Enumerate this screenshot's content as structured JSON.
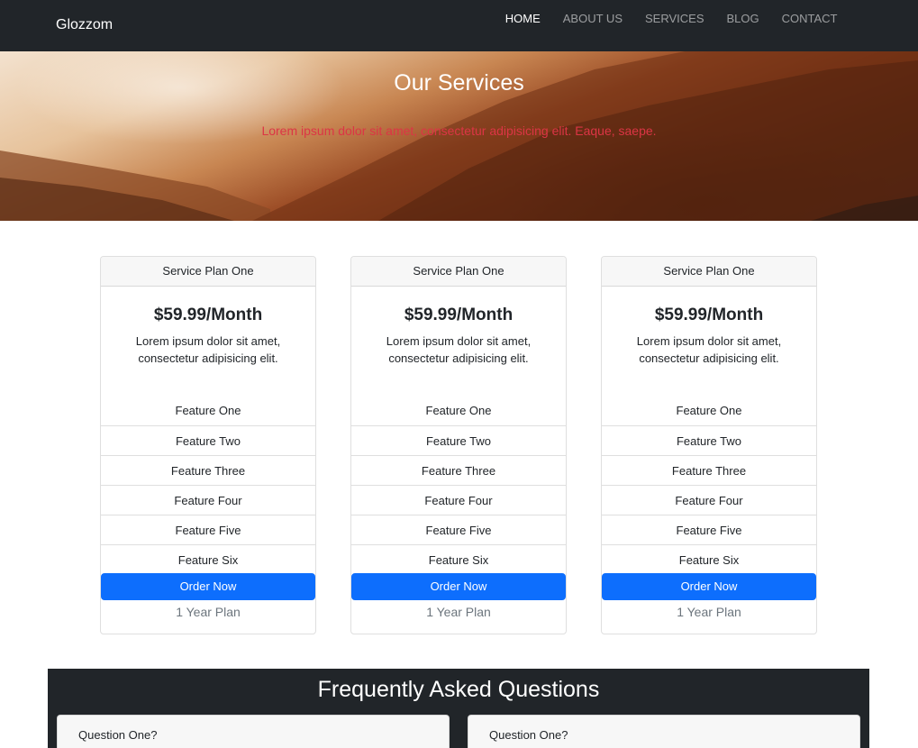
{
  "navbar": {
    "brand": "Glozzom",
    "links": [
      {
        "label": "HOME"
      },
      {
        "label": "ABOUT US"
      },
      {
        "label": "SERVICES"
      },
      {
        "label": "BLOG"
      },
      {
        "label": "CONTACT"
      }
    ]
  },
  "hero": {
    "title": "Our Services",
    "subtitle": "Lorem ipsum dolor sit amet, consectetur adipisicing elit. Eaque, saepe.",
    "subtitle_color": "#dc3545"
  },
  "plans": [
    {
      "header": "Service Plan One",
      "price": "$59.99/Month",
      "description": "Lorem ipsum dolor sit amet, consectetur adipisicing elit.",
      "features": [
        "Feature One",
        "Feature Two",
        "Feature Three",
        "Feature Four",
        "Feature Five",
        "Feature Six"
      ],
      "button": "Order Now",
      "term": "1 Year Plan"
    },
    {
      "header": "Service Plan One",
      "price": "$59.99/Month",
      "description": "Lorem ipsum dolor sit amet, consectetur adipisicing elit.",
      "features": [
        "Feature One",
        "Feature Two",
        "Feature Three",
        "Feature Four",
        "Feature Five",
        "Feature Six"
      ],
      "button": "Order Now",
      "term": "1 Year Plan"
    },
    {
      "header": "Service Plan One",
      "price": "$59.99/Month",
      "description": "Lorem ipsum dolor sit amet, consectetur adipisicing elit.",
      "features": [
        "Feature One",
        "Feature Two",
        "Feature Three",
        "Feature Four",
        "Feature Five",
        "Feature Six"
      ],
      "button": "Order Now",
      "term": "1 Year Plan"
    }
  ],
  "faq": {
    "title": "Frequently Asked Questions",
    "questions": [
      "Question One?",
      "Question One?"
    ]
  },
  "colors": {
    "navbar_bg": "#212529",
    "primary_button": "#0d6efd",
    "card_header_bg": "#f7f7f7"
  }
}
